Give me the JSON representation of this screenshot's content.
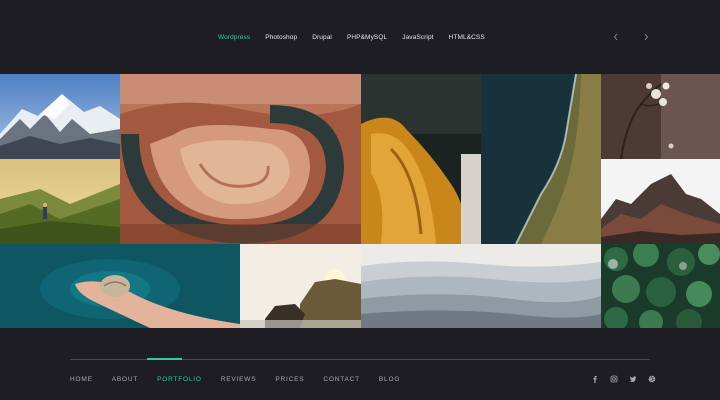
{
  "filters": [
    {
      "label": "Wordpress",
      "active": true
    },
    {
      "label": "Photoshop",
      "active": false
    },
    {
      "label": "Drupal",
      "active": false
    },
    {
      "label": "PHP&MySQL",
      "active": false
    },
    {
      "label": "JavaScript",
      "active": false
    },
    {
      "label": "HTML&CSS",
      "active": false
    }
  ],
  "gallery": {
    "images": [
      {
        "subject": "snowy mountain peaks"
      },
      {
        "subject": "horseshoe bend canyon"
      },
      {
        "subject": "golden fabric drape"
      },
      {
        "subject": "aerial coastline cliffs"
      },
      {
        "subject": "dry branch with blossoms"
      },
      {
        "subject": "hiker on green hill at sunset"
      },
      {
        "subject": "rocky mountain ridge"
      },
      {
        "subject": "hand holding seashell over teal water"
      },
      {
        "subject": "coastal rocks in sunlight"
      },
      {
        "subject": "misty mountain layers"
      },
      {
        "subject": "aerial pine forest"
      }
    ]
  },
  "footer": {
    "nav": [
      {
        "label": "HOME",
        "active": false
      },
      {
        "label": "ABOUT",
        "active": false
      },
      {
        "label": "PORTFOLIO",
        "active": true
      },
      {
        "label": "REVIEWS",
        "active": false
      },
      {
        "label": "PRICES",
        "active": false
      },
      {
        "label": "CONTACT",
        "active": false
      },
      {
        "label": "BLOG",
        "active": false
      }
    ],
    "social": [
      "facebook-icon",
      "instagram-icon",
      "twitter-icon",
      "dribbble-icon"
    ]
  },
  "colors": {
    "background": "#1f1d24",
    "accent": "#2ccf9c",
    "text": "#e6e6ea",
    "muted": "#a9a7b0"
  },
  "icons": {
    "prev": "chevron-left-icon",
    "next": "chevron-right-icon"
  }
}
